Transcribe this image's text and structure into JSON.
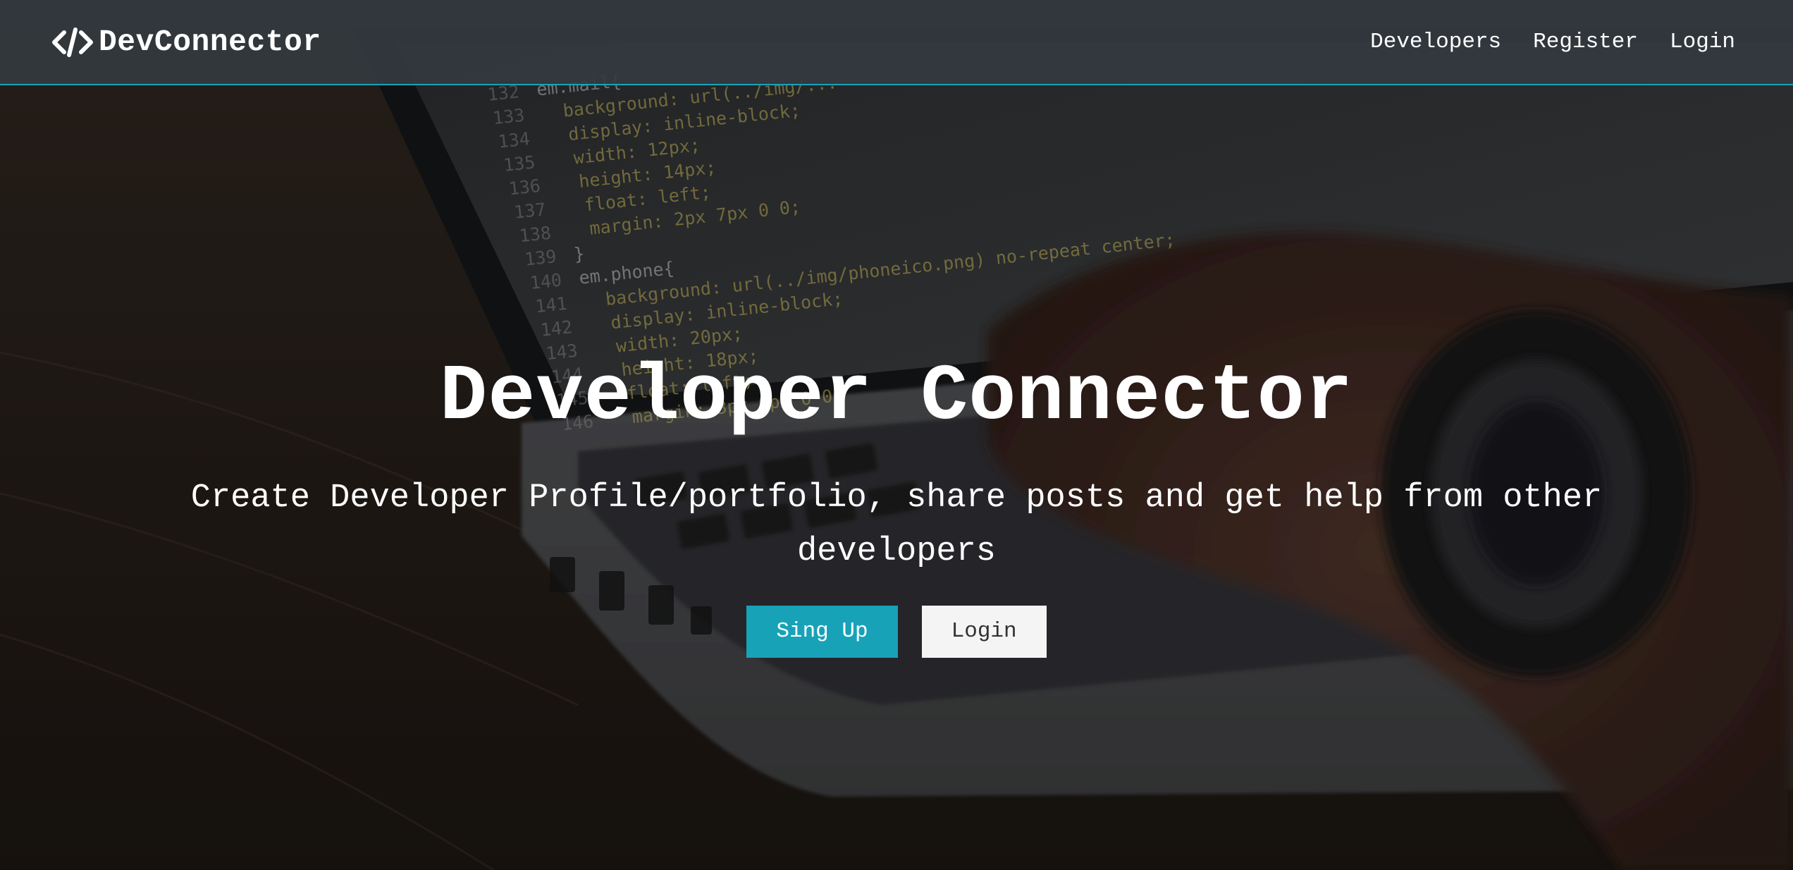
{
  "navbar": {
    "brand_symbol": "</>",
    "brand_text": "DevConnector",
    "links": [
      {
        "label": "Developers"
      },
      {
        "label": "Register"
      },
      {
        "label": "Login"
      }
    ],
    "accent_color": "#17a2b8"
  },
  "hero": {
    "title": "Developer Connector",
    "lead": "Create Developer Profile/portfolio, share posts and get help from other developers",
    "buttons": {
      "signup_label": "Sing Up",
      "login_label": "Login"
    }
  },
  "background": {
    "code_lines": [
      {
        "num": "132",
        "text": "em.mail{"
      },
      {
        "num": "133",
        "text": "  background: url(../img/..."
      },
      {
        "num": "134",
        "text": "  display: inline-block;"
      },
      {
        "num": "135",
        "text": "  width: 12px;"
      },
      {
        "num": "136",
        "text": "  height: 14px;"
      },
      {
        "num": "137",
        "text": "  float: left;"
      },
      {
        "num": "138",
        "text": "  margin: 2px 7px 0 0;"
      },
      {
        "num": "139",
        "text": "}"
      },
      {
        "num": "140",
        "text": "em.phone{"
      },
      {
        "num": "141",
        "text": "  background: url(../img/phoneico.png) no-repeat center;"
      },
      {
        "num": "142",
        "text": "  display: inline-block;"
      },
      {
        "num": "143",
        "text": "  width: 20px;"
      },
      {
        "num": "144",
        "text": "  height: 18px;"
      },
      {
        "num": "145",
        "text": "  float: left;"
      },
      {
        "num": "146",
        "text": "  margin: 3px 0px 0 0;"
      }
    ]
  }
}
